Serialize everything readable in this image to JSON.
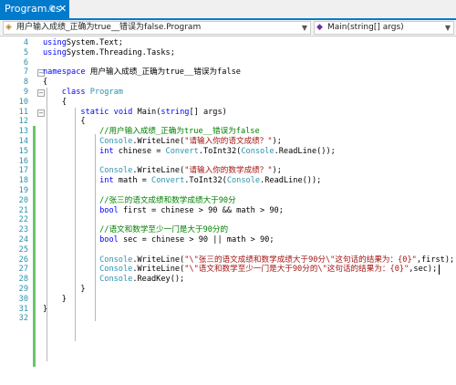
{
  "tab": {
    "title": "Program.cs",
    "pin_glyph": "⊕",
    "close_glyph": "✕"
  },
  "navbar": {
    "class_icon": "class-icon",
    "class_path": "用户输入成绩_正确为true__错误为false.Program",
    "method_icon": "method-icon",
    "member": "Main(string[] args)",
    "dropdown_glyph": "▼"
  },
  "colors": {
    "accent": "#007acc",
    "keyword": "#0000ff",
    "type": "#2b91af",
    "string": "#a31515",
    "comment": "#008000",
    "change_bar": "#6ac46a"
  },
  "editor": {
    "lines": [
      {
        "n": "4",
        "t": [
          [
            "kw",
            "using"
          ],
          [
            "",
            "System.Text;"
          ]
        ]
      },
      {
        "n": "5",
        "t": [
          [
            "kw",
            "using"
          ],
          [
            "",
            "System.Threading.Tasks;"
          ]
        ]
      },
      {
        "n": "6",
        "t": []
      },
      {
        "n": "7",
        "o": "⊟",
        "t": [
          [
            "kw",
            "namespace"
          ],
          [
            "",
            " 用户输入成绩_正确为true__错误为false"
          ]
        ]
      },
      {
        "n": "8",
        "t": [
          [
            "",
            "{"
          ]
        ]
      },
      {
        "n": "9",
        "o": "⊟",
        "t": [
          [
            "",
            "    "
          ],
          [
            "kw",
            "class"
          ],
          [
            "",
            " "
          ],
          [
            "ty",
            "Program"
          ]
        ]
      },
      {
        "n": "10",
        "t": [
          [
            "",
            "    {"
          ]
        ]
      },
      {
        "n": "11",
        "o": "⊟",
        "t": [
          [
            "",
            "        "
          ],
          [
            "kw",
            "static"
          ],
          [
            "",
            " "
          ],
          [
            "kw",
            "void"
          ],
          [
            "",
            " Main("
          ],
          [
            "kw",
            "string"
          ],
          [
            "",
            "[] args)"
          ]
        ]
      },
      {
        "n": "12",
        "t": [
          [
            "",
            "        {"
          ]
        ]
      },
      {
        "n": "13",
        "t": [
          [
            "",
            "            "
          ],
          [
            "cm",
            "//用户输入成绩_正确为true__错误为false"
          ]
        ]
      },
      {
        "n": "14",
        "t": [
          [
            "",
            "            "
          ],
          [
            "ty",
            "Console"
          ],
          [
            "",
            ".WriteLine("
          ],
          [
            "st",
            "\"请输入你的语文成绩？\""
          ],
          [
            "",
            ");"
          ]
        ]
      },
      {
        "n": "15",
        "t": [
          [
            "",
            "            "
          ],
          [
            "kw",
            "int"
          ],
          [
            "",
            " chinese = "
          ],
          [
            "ty",
            "Convert"
          ],
          [
            "",
            ".ToInt32("
          ],
          [
            "ty",
            "Console"
          ],
          [
            "",
            ".ReadLine());"
          ]
        ]
      },
      {
        "n": "16",
        "t": []
      },
      {
        "n": "17",
        "t": [
          [
            "",
            "            "
          ],
          [
            "ty",
            "Console"
          ],
          [
            "",
            ".WriteLine("
          ],
          [
            "st",
            "\"请输入你的数学成绩？\""
          ],
          [
            "",
            ");"
          ]
        ]
      },
      {
        "n": "18",
        "t": [
          [
            "",
            "            "
          ],
          [
            "kw",
            "int"
          ],
          [
            "",
            " math = "
          ],
          [
            "ty",
            "Convert"
          ],
          [
            "",
            ".ToInt32("
          ],
          [
            "ty",
            "Console"
          ],
          [
            "",
            ".ReadLine());"
          ]
        ]
      },
      {
        "n": "19",
        "t": []
      },
      {
        "n": "20",
        "t": [
          [
            "",
            "            "
          ],
          [
            "cm",
            "//张三的语文成绩和数学成绩大于90分"
          ]
        ]
      },
      {
        "n": "21",
        "t": [
          [
            "",
            "            "
          ],
          [
            "kw",
            "bool"
          ],
          [
            "",
            " first = chinese > 90 && math > 90;"
          ]
        ]
      },
      {
        "n": "22",
        "t": []
      },
      {
        "n": "23",
        "t": [
          [
            "",
            "            "
          ],
          [
            "cm",
            "//语文和数学至少一门是大于90分的"
          ]
        ]
      },
      {
        "n": "24",
        "t": [
          [
            "",
            "            "
          ],
          [
            "kw",
            "bool"
          ],
          [
            "",
            " sec = chinese > 90 || math > 90;"
          ]
        ]
      },
      {
        "n": "25",
        "t": []
      },
      {
        "n": "26",
        "t": [
          [
            "",
            "            "
          ],
          [
            "ty",
            "Console"
          ],
          [
            "",
            ".WriteLine("
          ],
          [
            "st",
            "\"\\\"张三的语文成绩和数学成绩大于90分\\\"这句话的结果为：{0}\""
          ],
          [
            "",
            ",first);"
          ]
        ]
      },
      {
        "n": "27",
        "t": [
          [
            "",
            "            "
          ],
          [
            "ty",
            "Console"
          ],
          [
            "",
            ".WriteLine("
          ],
          [
            "st",
            "\"\\\"语文和数学至少一门是大于90分的\\\"这句话的结果为：{0}\""
          ],
          [
            "",
            ",sec);"
          ]
        ]
      },
      {
        "n": "28",
        "t": [
          [
            "",
            "            "
          ],
          [
            "ty",
            "Console"
          ],
          [
            "",
            ".ReadKey();"
          ]
        ]
      },
      {
        "n": "29",
        "t": [
          [
            "",
            "        }"
          ]
        ]
      },
      {
        "n": "30",
        "t": [
          [
            "",
            "    }"
          ]
        ]
      },
      {
        "n": "31",
        "t": [
          [
            "",
            "}"
          ]
        ]
      },
      {
        "n": "32",
        "t": []
      }
    ]
  }
}
